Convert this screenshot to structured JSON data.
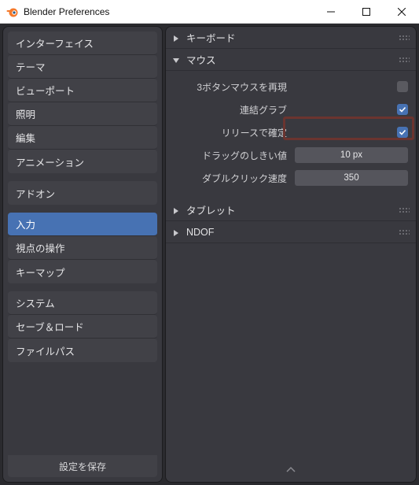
{
  "window": {
    "title": "Blender Preferences"
  },
  "sidebar": {
    "groups": [
      {
        "items": [
          "インターフェイス",
          "テーマ",
          "ビューポート",
          "照明",
          "編集",
          "アニメーション"
        ]
      },
      {
        "items": [
          "アドオン"
        ]
      },
      {
        "items": [
          "入力",
          "視点の操作",
          "キーマップ"
        ]
      },
      {
        "items": [
          "システム",
          "セーブ＆ロード",
          "ファイルパス"
        ]
      }
    ],
    "active": "入力",
    "save_label": "設定を保存"
  },
  "panels": {
    "keyboard": {
      "title": "キーボード",
      "open": false
    },
    "mouse": {
      "title": "マウス",
      "open": true,
      "emulate_3button": {
        "label": "3ボタンマウスを再現",
        "checked": false
      },
      "continuous_grab": {
        "label": "連結グラブ",
        "checked": true
      },
      "confirm_release": {
        "label": "リリースで確定",
        "checked": true
      },
      "drag_threshold": {
        "label": "ドラッグのしきい値",
        "value": "10 px"
      },
      "dblclick_speed": {
        "label": "ダブルクリック速度",
        "value": "350"
      }
    },
    "tablet": {
      "title": "タブレット",
      "open": false
    },
    "ndof": {
      "title": "NDOF",
      "open": false
    }
  }
}
